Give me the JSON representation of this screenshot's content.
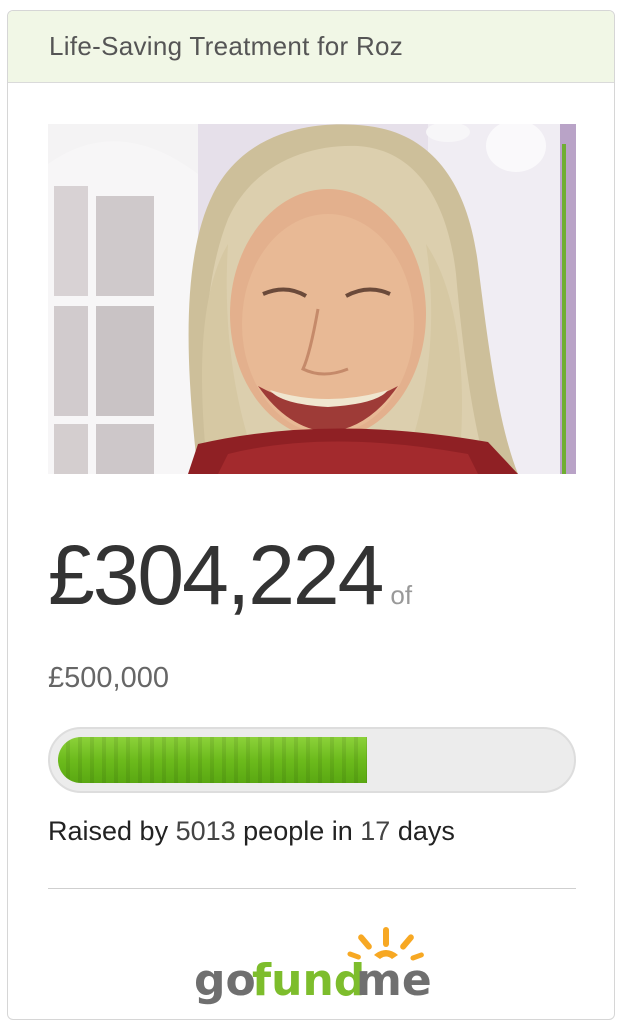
{
  "campaign": {
    "title": "Life-Saving Treatment for Roz",
    "photo_label": "Photo of Roz"
  },
  "funding": {
    "raised": "£304,224",
    "of_label": "of",
    "goal": "£500,000",
    "progress_fraction": 0.608,
    "raised_by_prefix": "Raised by ",
    "donor_count": "5013",
    "people_in": " people in ",
    "days_count": "17",
    "days_suffix": " days"
  },
  "brand": {
    "logo_go": "go",
    "logo_fund": "fund",
    "logo_me": "me",
    "logo_icon": "sun-rays-icon"
  },
  "colors": {
    "header_bg": "#f1f7e6",
    "progress_green": "#6cbb1c",
    "logo_green": "#7dbd2c",
    "logo_gray": "#6f6f6f",
    "logo_orange": "#f7a823"
  }
}
